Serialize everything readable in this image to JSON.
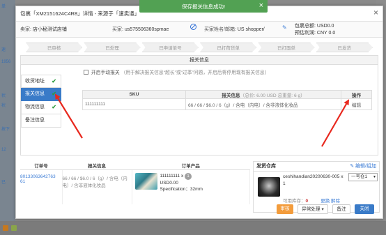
{
  "background": {
    "left_snippets": [
      "单",
      "速",
      "1956",
      "状",
      "状",
      "按下",
      "12",
      "已"
    ],
    "right_snippets": []
  },
  "toast": {
    "text": "保存报关信息成功!",
    "close": "×"
  },
  "modal": {
    "title": "包裹「XM2151624C4R8」详情 - 来源于「速卖通」",
    "close": "×",
    "info": {
      "seller_label": "卖家:",
      "seller_value": "店小秘测试店铺",
      "buyer_label": "买家:",
      "buyer_value": "us575506360spmae",
      "buyer_name_label": "买家姓名/邮箱:",
      "buyer_name_value": "US shopper/",
      "total_label": "包裹总额:",
      "total_value": "USD0.0",
      "profit_label": "预估利润:",
      "profit_value": "CNY 0.0"
    },
    "steps": [
      "已审核",
      "已处理",
      "已申请单号",
      "已打荷货单",
      "已打面单",
      "已发货"
    ],
    "customs": {
      "header": "报关信息",
      "tabs": [
        {
          "label": "收货地址",
          "done": "✔"
        },
        {
          "label": "报关信息",
          "done": "✔"
        },
        {
          "label": "物流信息",
          "done": "✔"
        },
        {
          "label": "备注信息",
          "done": ""
        }
      ],
      "manual_label": "开启手动报关",
      "manual_hint": "（用于解决报关信息“超长”或“过季”问题，开启后将停用现有报关信息）",
      "table_headers": {
        "sku": "SKU",
        "info": "报关信息",
        "info_total": "（总价: 6.00 USD 总重量: 6 g）",
        "action": "操作"
      },
      "rows": [
        {
          "sku": "111111111",
          "info": "66 / 66 / $6.0 / 6（g）/ 含电（内电）/ 含非液体化妆品",
          "action": "编辑"
        }
      ]
    },
    "order": {
      "headers": {
        "order_no": "订单号",
        "customs": "报关信息",
        "product": "订单产品"
      },
      "order_no": "80133063642763 61",
      "customs": "66 / 66 / $6.0 / 6（g）/ 含电（内电）/ 含非液体化妆品",
      "product_name": "111111111 x",
      "product_qty": "1",
      "product_price": "USD0.00",
      "product_spec": "Specification：32mm"
    },
    "warehouse": {
      "header": "发货仓库",
      "edit": "编辑/组加",
      "sku": "ceshihandian20200630-005 x",
      "qty": "1",
      "select_value": "一号仓1",
      "stock_label": "可用库存：",
      "stock_value": "0",
      "replace": "更换",
      "unbind": "解除"
    },
    "buttons": {
      "audit": "审核",
      "exception": "异常处理 ▾",
      "remark": "备注",
      "close": "关闭"
    }
  },
  "colors": {
    "toast": "#52a153",
    "primary": "#3a7bc8",
    "check": "#2e9c3f",
    "annotation": "#e8281e",
    "audit": "#f39c3c"
  }
}
